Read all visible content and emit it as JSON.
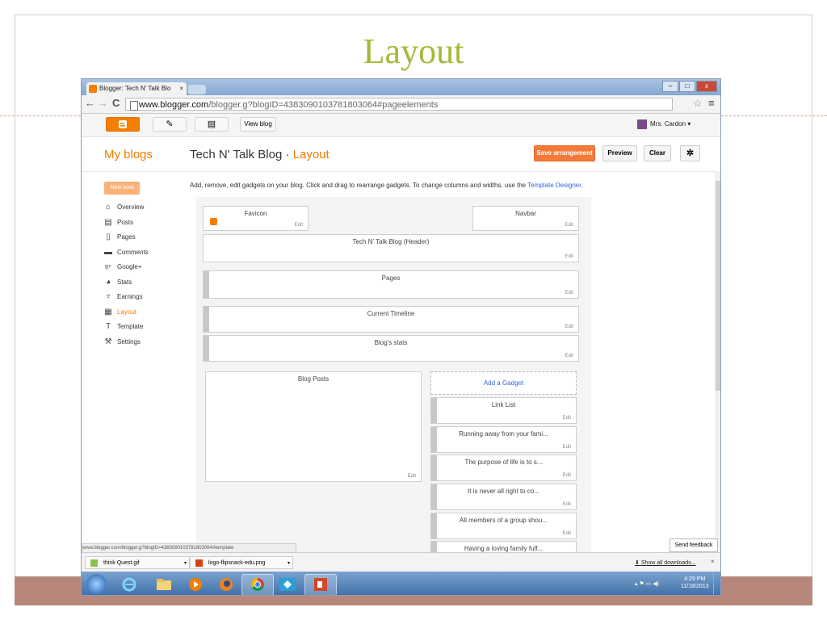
{
  "slide": {
    "title": "Layout"
  },
  "browser": {
    "tab_title": "Blogger: Tech N' Talk Blo",
    "tab_close": "×",
    "back": "←",
    "forward": "→",
    "reload": "C",
    "url_host": "www.blogger.com",
    "url_path": "/blogger.g?blogID=4383090103781803064#pageelements",
    "star": "☆",
    "menu": "≡",
    "win_min": "–",
    "win_max": "□",
    "win_close": "x"
  },
  "blogger": {
    "view_blog": "View blog",
    "user_name": "Mrs. Cardon",
    "user_caret": "▾",
    "my_blogs": "My blogs",
    "blog_name": "Tech N' Talk Blog",
    "separator": "·",
    "section": "Layout",
    "save_arrangement": "Save arrangement",
    "preview": "Preview",
    "clear": "Clear",
    "new_post": "New post",
    "instructions": "Add, remove, edit gadgets on your blog. Click and drag to rearrange gadgets. To change columns and widths, use the",
    "template_designer": "Template Designer",
    "instructions_end": ".",
    "sidebar": [
      {
        "label": "Overview",
        "icon": "home-icon",
        "glyph": "⌂"
      },
      {
        "label": "Posts",
        "icon": "posts-icon",
        "glyph": "▤"
      },
      {
        "label": "Pages",
        "icon": "pages-icon",
        "glyph": "▯"
      },
      {
        "label": "Comments",
        "icon": "comments-icon",
        "glyph": "▬"
      },
      {
        "label": "Google+",
        "icon": "google-plus-icon",
        "glyph": "g+"
      },
      {
        "label": "Stats",
        "icon": "stats-icon",
        "glyph": "◕"
      },
      {
        "label": "Earnings",
        "icon": "trophy-icon",
        "glyph": "♆"
      },
      {
        "label": "Layout",
        "icon": "layout-icon",
        "glyph": "▦"
      },
      {
        "label": "Template",
        "icon": "template-icon",
        "glyph": "T"
      },
      {
        "label": "Settings",
        "icon": "wrench-icon",
        "glyph": "⚒"
      }
    ],
    "gadgets": {
      "favicon": "Favicon",
      "navbar": "Navbar",
      "header": "Tech N' Talk Blog (Header)",
      "pages": "Pages",
      "timeline": "Current Timeline",
      "stats": "Blog's stats",
      "blog_posts": "Blog Posts",
      "add_gadget": "Add a Gadget",
      "link_list": "Link List",
      "side": [
        "Running away from your fami...",
        "The purpose of life is to s...",
        "It is never all right to co...",
        "All members of a group shou...",
        "Having a loving family fulf..."
      ],
      "edit": "Edit"
    },
    "send_feedback": "Send feedback",
    "status_url": "www.blogger.com/blogger.g?blogID=4383090103781803064#template"
  },
  "downloads": {
    "items": [
      "think Quest.gif",
      "logo-flipsnack-edu.png"
    ],
    "caret": "▾",
    "show_all": "Show all downloads...",
    "close": "×"
  },
  "taskbar": {
    "time": "4:29 PM",
    "date": "11/18/2013",
    "tray": "▴  ⚑  ▭  ◀)"
  },
  "colors": {
    "brand": "#f57d00",
    "title": "#a6b83a",
    "footer": "#b6877a"
  }
}
